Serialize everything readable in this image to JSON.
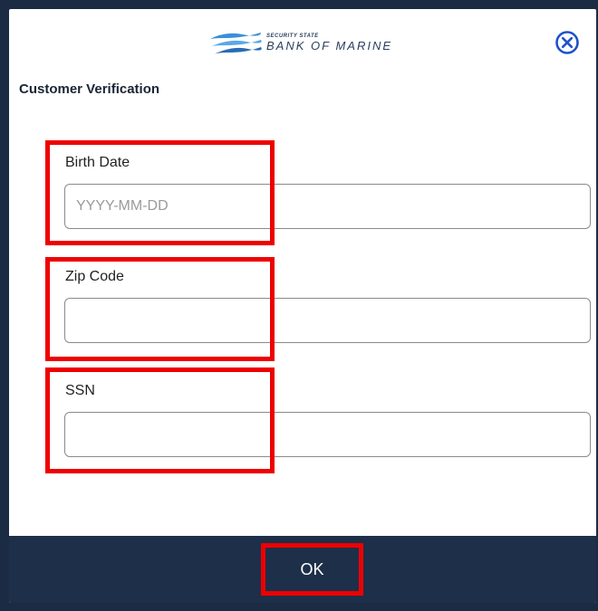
{
  "brand": {
    "small_text": "SECURITY STATE",
    "name": "BANK OF MARINE"
  },
  "dialog": {
    "title": "Customer Verification",
    "close_icon": "close-circle-icon"
  },
  "fields": [
    {
      "label": "Birth Date",
      "placeholder": "YYYY-MM-DD",
      "value": ""
    },
    {
      "label": "Zip Code",
      "placeholder": "",
      "value": ""
    },
    {
      "label": "SSN",
      "placeholder": "",
      "value": ""
    }
  ],
  "footer": {
    "ok_label": "OK"
  },
  "colors": {
    "accent": "#1e2f49",
    "highlight": "#ee0000",
    "close_icon": "#1f52c9"
  }
}
